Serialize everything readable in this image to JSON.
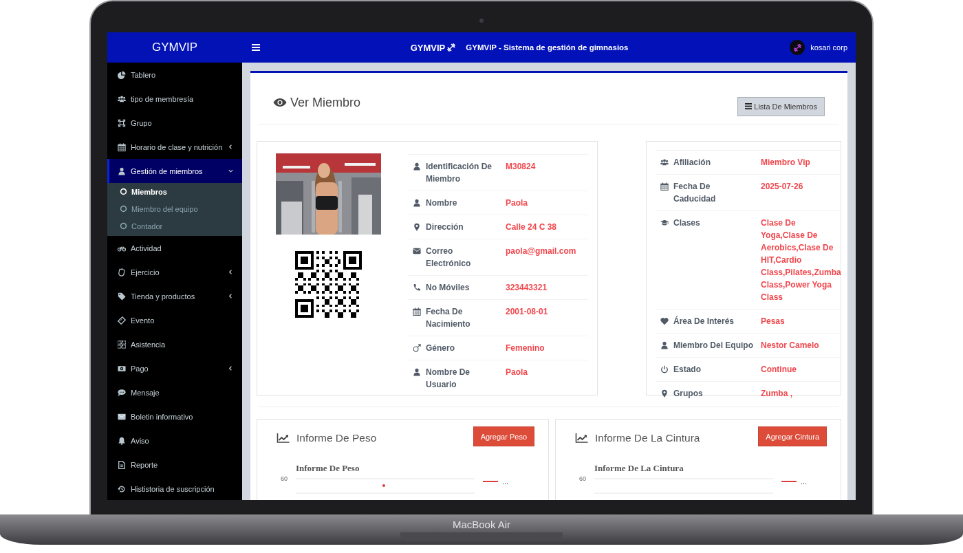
{
  "header": {
    "brand": "GYMVIP",
    "logo_text": "GYMVIP",
    "title": "GYMVIP - Sistema de gestión de gimnasios",
    "user": "kosari corp"
  },
  "sidebar": {
    "items": [
      {
        "label": "Tablero",
        "selected": false
      },
      {
        "label": "tipo de membresía",
        "selected": false
      },
      {
        "label": "Grupo",
        "selected": false
      },
      {
        "label": "Horario de clase y nutrición",
        "selected": false,
        "expanded": false
      },
      {
        "label": "Gestión de miembros",
        "selected": true,
        "expanded": true,
        "children": [
          {
            "label": "Miembros",
            "selected": true
          },
          {
            "label": "Miembro del equipo",
            "selected": false
          },
          {
            "label": "Contador",
            "selected": false
          }
        ]
      },
      {
        "label": "Actividad",
        "selected": false
      },
      {
        "label": "Ejercicio",
        "selected": false,
        "expanded": false
      },
      {
        "label": "Tienda y productos",
        "selected": false,
        "expanded": false
      },
      {
        "label": "Evento",
        "selected": false
      },
      {
        "label": "Asistencia",
        "selected": false
      },
      {
        "label": "Pago",
        "selected": false,
        "expanded": false
      },
      {
        "label": "Mensaje",
        "selected": false
      },
      {
        "label": "Boletin informativo",
        "selected": false
      },
      {
        "label": "Aviso",
        "selected": false
      },
      {
        "label": "Reporte",
        "selected": false
      },
      {
        "label": "Hististoria de suscripción",
        "selected": false
      }
    ]
  },
  "page": {
    "title": "Ver Miembro",
    "list_button": "Lista De Miembros"
  },
  "member": {
    "fields": [
      {
        "label": "Identificación De Miembro",
        "value": "M30824"
      },
      {
        "label": "Nombre",
        "value": "Paola"
      },
      {
        "label": "Dirección",
        "value": "Calle 24 C 38"
      },
      {
        "label": "Correo Electrónico",
        "value": "paola@gmail.com"
      },
      {
        "label": "No Móviles",
        "value": "323443321"
      },
      {
        "label": "Fecha De Nacimiento",
        "value": "2001-08-01"
      },
      {
        "label": "Género",
        "value": "Femenino"
      },
      {
        "label": "Nombre De Usuario",
        "value": "Paola"
      }
    ]
  },
  "membership": {
    "fields": [
      {
        "label": "Afiliación",
        "value": "Miembro Vip"
      },
      {
        "label": "Fecha De Caducidad",
        "value": "2025-07-26"
      },
      {
        "label": "Clases",
        "value": "Clase De Yoga,Clase De Aerobics,Clase De HIT,Cardio Class,Pilates,Zumba Class,Power Yoga Class"
      },
      {
        "label": "Área De Interés",
        "value": "Pesas"
      },
      {
        "label": "Miembro Del Equipo",
        "value": "Nestor Camelo"
      },
      {
        "label": "Estado",
        "value": "Continue"
      },
      {
        "label": "Grupos",
        "value": "Zumba ,"
      }
    ]
  },
  "reports": [
    {
      "title": "Informe De Peso",
      "button": "Agregar Peso",
      "chart_title": "Informe De Peso",
      "y_tick": "60",
      "legend": "...",
      "has_point": true
    },
    {
      "title": "Informe De La Cintura",
      "button": "Agregar Cintura",
      "chart_title": "Informe De La Cintura",
      "y_tick": "60",
      "legend": "...",
      "has_point": false
    }
  ],
  "device": {
    "label": "MacBook Air"
  }
}
